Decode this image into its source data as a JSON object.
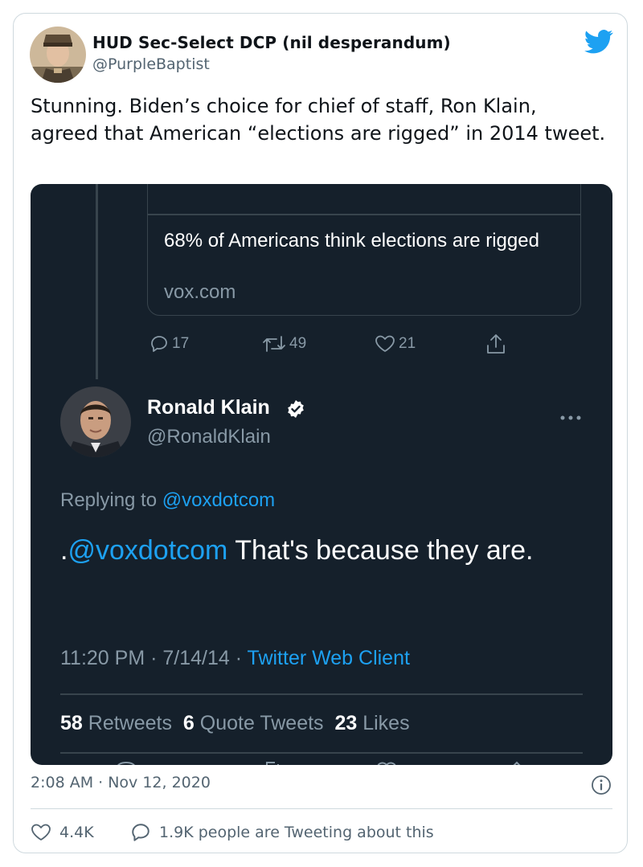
{
  "author": {
    "name": "HUD Sec-Select DCP (nil desperandum)",
    "handle": "@PurpleBaptist",
    "avatar_icon": "avatar-cadet-photo"
  },
  "tweet": {
    "text": "Stunning. Biden’s choice for chief of staff, Ron Klain, agreed that American “elections are rigged” in 2014 tweet.",
    "timestamp": "2:08 AM · Nov 12, 2020",
    "likes": "4.4K",
    "tweeting_about": "1.9K people are Tweeting about this"
  },
  "screenshot": {
    "link_card": {
      "title": "68% of Americans think elections are rigged",
      "domain": "vox.com"
    },
    "parent_actions": {
      "replies": "17",
      "retweets": "49",
      "likes": "21"
    },
    "quoted": {
      "name": "Ronald Klain",
      "handle": "@RonaldKlain",
      "replying_prefix": "Replying to ",
      "replying_to": "@voxdotcom",
      "text_prefix": ".",
      "mention": "@voxdotcom",
      "text_rest": " That's because they are.",
      "time_date": "11:20 PM · 7/14/14 · ",
      "client": "Twitter Web Client",
      "retweets_count": "58",
      "retweets_label": " Retweets",
      "quotes_count": "6",
      "quotes_label": " Quote Tweets",
      "likes_count": "23",
      "likes_label": " Likes"
    }
  },
  "colors": {
    "twitter_blue": "#1da1f2",
    "dim_background": "#15202b",
    "dim_secondary_text": "#8899a6",
    "like_icon": "#536471"
  }
}
